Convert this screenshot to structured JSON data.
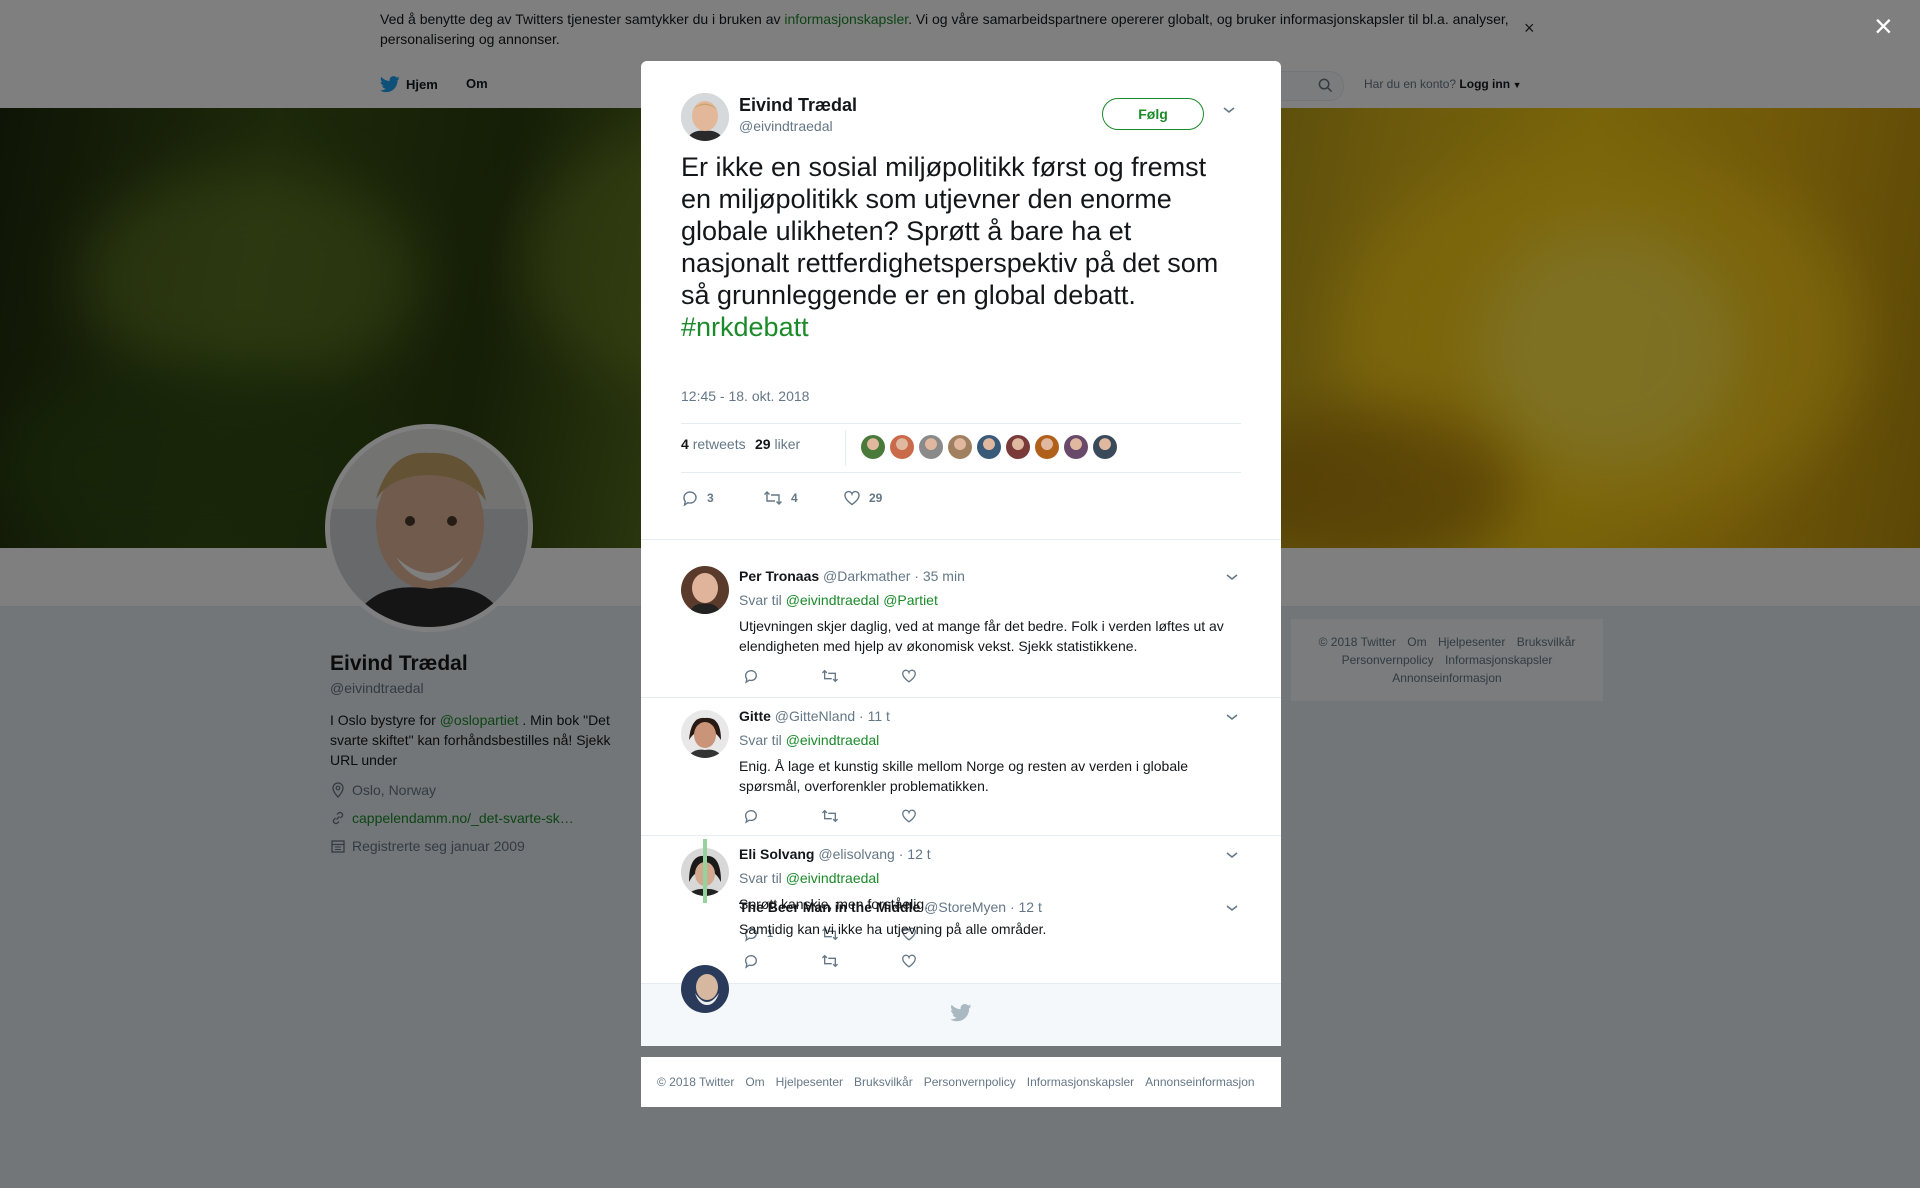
{
  "cookie": {
    "text_pre": "Ved å benytte deg av Twitters tjenester samtykker du i bruken av ",
    "link": "informasjonskapsler",
    "text_post": ". Vi og våre samarbeidspartnere opererer globalt, og bruker informasjonskapsler til bl.a. analyser, personalisering og annonser.",
    "close": "×"
  },
  "nav": {
    "home": "Hjem",
    "about": "Om",
    "account_prompt": "Har du en konto?",
    "login": "Logg inn"
  },
  "profile": {
    "name": "Eivind Trædal",
    "handle": "@eivindtraedal",
    "bio_pre": "I Oslo bystyre for ",
    "bio_link": "@oslopartiet",
    "bio_post": " . Min bok \"Det svarte skiftet\" kan forhåndsbestilles nå! Sjekk URL under",
    "location": "Oslo, Norway",
    "url": "cappelendamm.no/_det-svarte-sk…",
    "joined": "Registrerte seg januar 2009"
  },
  "side_footer": [
    "© 2018 Twitter",
    "Om",
    "Hjelpesenter",
    "Bruksvilkår",
    "Personvernpolicy",
    "Informasjonskapsler",
    "Annonseinformasjon"
  ],
  "overlay_close": "×",
  "tweet": {
    "name": "Eivind Trædal",
    "handle": "@eivindtraedal",
    "follow": "Følg",
    "text": "Er ikke en sosial miljøpolitikk først og fremst en miljøpolitikk som utjevner den enorme globale ulikheten? Sprøtt å bare ha et nasjonalt rettferdighetsperspektiv på det som så grunnleggende er en global debatt.",
    "hashtag": "#nrkdebatt",
    "timestamp": "12:45 - 18. okt. 2018",
    "retweets_count": "4",
    "retweets_label": "retweets",
    "likes_count": "29",
    "likes_label": "liker",
    "reply_count": "3",
    "retweet_count": "4",
    "like_count": "29",
    "liker_colors": [
      "#4a7a3a",
      "#c96a4a",
      "#8a8a8a",
      "#a08060",
      "#3a5a7a",
      "#7a3a3a",
      "#b0601a",
      "#6a4a6a",
      "#3a4a5a"
    ]
  },
  "replies": [
    {
      "name": "Per Tronaas",
      "handle": "@Darkmather",
      "time": "· 35 min",
      "reply_to_label": "Svar til",
      "reply_to": [
        "@eivindtraedal",
        "@Partiet"
      ],
      "text": "Utjevningen skjer daglig, ved at mange får det bedre. Folk i verden løftes ut av elendigheten med hjelp av økonomisk vekst. Sjekk statistikkene.",
      "reply_count": ""
    },
    {
      "name": "Gitte",
      "handle": "@GitteNland",
      "time": "· 11 t",
      "reply_to_label": "Svar til",
      "reply_to": [
        "@eivindtraedal"
      ],
      "text": "Enig. Å lage et kunstig skille mellom Norge og resten av verden i globale spørsmål, overforenkler problematikken.",
      "reply_count": ""
    },
    {
      "name": "Eli Solvang",
      "handle": "@elisolvang",
      "time": "· 12 t",
      "reply_to_label": "Svar til",
      "reply_to": [
        "@eivindtraedal"
      ],
      "text": "Sprøtt kanskje, men forståelig.",
      "reply_count": "1"
    },
    {
      "name": "The Beer Man in the Middle",
      "handle": "@StoreMyen",
      "time": "· 12 t",
      "text": "Samtidig kan vi ikke ha utjevning på alle områder.",
      "reply_count": ""
    }
  ],
  "modal_footer": [
    "© 2018 Twitter",
    "Om",
    "Hjelpesenter",
    "Bruksvilkår",
    "Personvernpolicy",
    "Informasjonskapsler",
    "Annonseinformasjon"
  ]
}
